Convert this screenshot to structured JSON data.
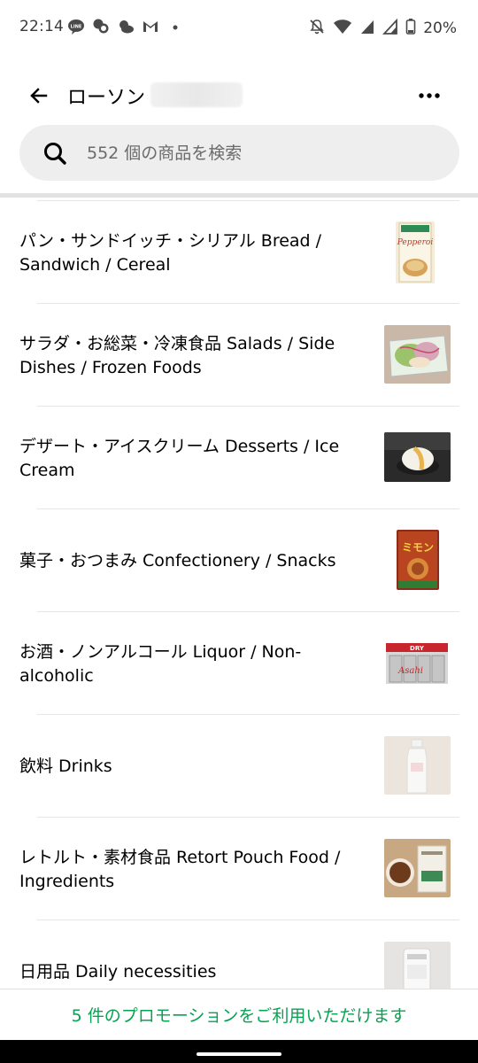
{
  "status_bar": {
    "time": "22:14",
    "battery": "20%",
    "left_icons": [
      "line-icon",
      "chat-icon",
      "weather-icon",
      "gmail-icon",
      "dot-icon"
    ],
    "right_icons": [
      "mute-icon",
      "wifi-icon",
      "signal-icon",
      "signal-icon-2",
      "battery-icon"
    ]
  },
  "header": {
    "store_name": "ローソン",
    "back_icon": "arrow-left-icon",
    "more_icon": "more-horizontal-icon"
  },
  "search": {
    "placeholder": "552 個の商品を検索",
    "icon": "search-icon"
  },
  "categories": [
    {
      "label": "パン・サンドイッチ・シリアル Bread / Sandwich / Cereal",
      "thumb": "bread-product-thumb"
    },
    {
      "label": "サラダ・お総菜・冷凍食品 Salads / Side Dishes / Frozen Foods",
      "thumb": "salad-product-thumb"
    },
    {
      "label": "デザート・アイスクリーム Desserts / Ice Cream",
      "thumb": "dessert-product-thumb"
    },
    {
      "label": "菓子・おつまみ Confectionery / Snacks",
      "thumb": "snack-product-thumb"
    },
    {
      "label": "お酒・ノンアルコール Liquor / Non-alcoholic",
      "thumb": "beer-product-thumb"
    },
    {
      "label": "飲料 Drinks",
      "thumb": "water-bottle-thumb"
    },
    {
      "label": "レトルト・素材食品 Retort Pouch Food / Ingredients",
      "thumb": "retort-food-thumb"
    },
    {
      "label": "日用品 Daily necessities",
      "thumb": "daily-goods-thumb"
    }
  ],
  "promo": {
    "text": "5 件のプロモーションをご利用いただけます"
  },
  "colors": {
    "accent_green": "#06a351",
    "search_bg": "#eeeeee",
    "divider": "#e6e6e6"
  }
}
